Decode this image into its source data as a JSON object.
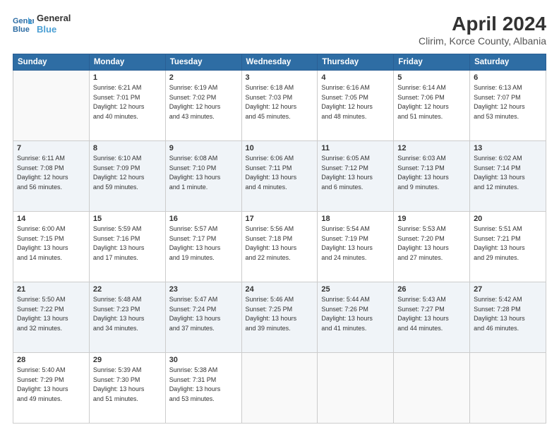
{
  "header": {
    "logo_line1": "General",
    "logo_line2": "Blue",
    "title": "April 2024",
    "subtitle": "Clirim, Korce County, Albania"
  },
  "weekdays": [
    "Sunday",
    "Monday",
    "Tuesday",
    "Wednesday",
    "Thursday",
    "Friday",
    "Saturday"
  ],
  "weeks": [
    [
      {
        "num": "",
        "info": ""
      },
      {
        "num": "1",
        "info": "Sunrise: 6:21 AM\nSunset: 7:01 PM\nDaylight: 12 hours\nand 40 minutes."
      },
      {
        "num": "2",
        "info": "Sunrise: 6:19 AM\nSunset: 7:02 PM\nDaylight: 12 hours\nand 43 minutes."
      },
      {
        "num": "3",
        "info": "Sunrise: 6:18 AM\nSunset: 7:03 PM\nDaylight: 12 hours\nand 45 minutes."
      },
      {
        "num": "4",
        "info": "Sunrise: 6:16 AM\nSunset: 7:05 PM\nDaylight: 12 hours\nand 48 minutes."
      },
      {
        "num": "5",
        "info": "Sunrise: 6:14 AM\nSunset: 7:06 PM\nDaylight: 12 hours\nand 51 minutes."
      },
      {
        "num": "6",
        "info": "Sunrise: 6:13 AM\nSunset: 7:07 PM\nDaylight: 12 hours\nand 53 minutes."
      }
    ],
    [
      {
        "num": "7",
        "info": "Sunrise: 6:11 AM\nSunset: 7:08 PM\nDaylight: 12 hours\nand 56 minutes."
      },
      {
        "num": "8",
        "info": "Sunrise: 6:10 AM\nSunset: 7:09 PM\nDaylight: 12 hours\nand 59 minutes."
      },
      {
        "num": "9",
        "info": "Sunrise: 6:08 AM\nSunset: 7:10 PM\nDaylight: 13 hours\nand 1 minute."
      },
      {
        "num": "10",
        "info": "Sunrise: 6:06 AM\nSunset: 7:11 PM\nDaylight: 13 hours\nand 4 minutes."
      },
      {
        "num": "11",
        "info": "Sunrise: 6:05 AM\nSunset: 7:12 PM\nDaylight: 13 hours\nand 6 minutes."
      },
      {
        "num": "12",
        "info": "Sunrise: 6:03 AM\nSunset: 7:13 PM\nDaylight: 13 hours\nand 9 minutes."
      },
      {
        "num": "13",
        "info": "Sunrise: 6:02 AM\nSunset: 7:14 PM\nDaylight: 13 hours\nand 12 minutes."
      }
    ],
    [
      {
        "num": "14",
        "info": "Sunrise: 6:00 AM\nSunset: 7:15 PM\nDaylight: 13 hours\nand 14 minutes."
      },
      {
        "num": "15",
        "info": "Sunrise: 5:59 AM\nSunset: 7:16 PM\nDaylight: 13 hours\nand 17 minutes."
      },
      {
        "num": "16",
        "info": "Sunrise: 5:57 AM\nSunset: 7:17 PM\nDaylight: 13 hours\nand 19 minutes."
      },
      {
        "num": "17",
        "info": "Sunrise: 5:56 AM\nSunset: 7:18 PM\nDaylight: 13 hours\nand 22 minutes."
      },
      {
        "num": "18",
        "info": "Sunrise: 5:54 AM\nSunset: 7:19 PM\nDaylight: 13 hours\nand 24 minutes."
      },
      {
        "num": "19",
        "info": "Sunrise: 5:53 AM\nSunset: 7:20 PM\nDaylight: 13 hours\nand 27 minutes."
      },
      {
        "num": "20",
        "info": "Sunrise: 5:51 AM\nSunset: 7:21 PM\nDaylight: 13 hours\nand 29 minutes."
      }
    ],
    [
      {
        "num": "21",
        "info": "Sunrise: 5:50 AM\nSunset: 7:22 PM\nDaylight: 13 hours\nand 32 minutes."
      },
      {
        "num": "22",
        "info": "Sunrise: 5:48 AM\nSunset: 7:23 PM\nDaylight: 13 hours\nand 34 minutes."
      },
      {
        "num": "23",
        "info": "Sunrise: 5:47 AM\nSunset: 7:24 PM\nDaylight: 13 hours\nand 37 minutes."
      },
      {
        "num": "24",
        "info": "Sunrise: 5:46 AM\nSunset: 7:25 PM\nDaylight: 13 hours\nand 39 minutes."
      },
      {
        "num": "25",
        "info": "Sunrise: 5:44 AM\nSunset: 7:26 PM\nDaylight: 13 hours\nand 41 minutes."
      },
      {
        "num": "26",
        "info": "Sunrise: 5:43 AM\nSunset: 7:27 PM\nDaylight: 13 hours\nand 44 minutes."
      },
      {
        "num": "27",
        "info": "Sunrise: 5:42 AM\nSunset: 7:28 PM\nDaylight: 13 hours\nand 46 minutes."
      }
    ],
    [
      {
        "num": "28",
        "info": "Sunrise: 5:40 AM\nSunset: 7:29 PM\nDaylight: 13 hours\nand 49 minutes."
      },
      {
        "num": "29",
        "info": "Sunrise: 5:39 AM\nSunset: 7:30 PM\nDaylight: 13 hours\nand 51 minutes."
      },
      {
        "num": "30",
        "info": "Sunrise: 5:38 AM\nSunset: 7:31 PM\nDaylight: 13 hours\nand 53 minutes."
      },
      {
        "num": "",
        "info": ""
      },
      {
        "num": "",
        "info": ""
      },
      {
        "num": "",
        "info": ""
      },
      {
        "num": "",
        "info": ""
      }
    ]
  ]
}
